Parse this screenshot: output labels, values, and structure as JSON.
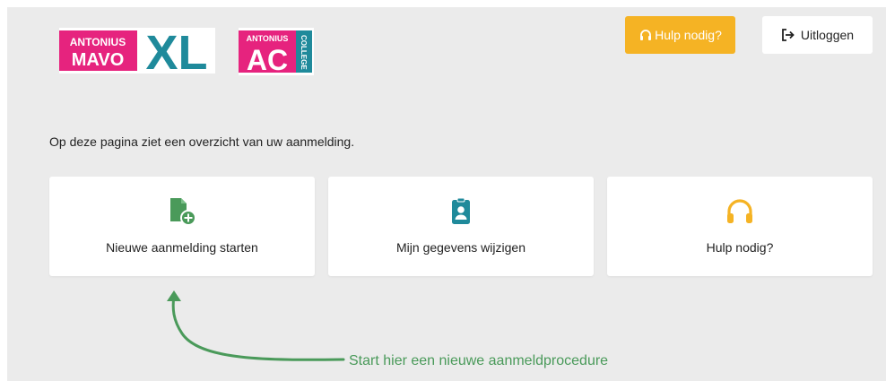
{
  "header": {
    "logo_mavo": {
      "line1": "ANTONIUS",
      "line2": "MAVO",
      "suffix": "XL"
    },
    "logo_college": {
      "line1": "ANTONIUS",
      "letters": "AC",
      "side": "COLLEGE"
    },
    "help_button_label": "Hulp nodig?",
    "logout_button_label": "Uitloggen"
  },
  "intro_text": "Op deze pagina ziet een overzicht van uw aanmelding.",
  "cards": [
    {
      "label": "Nieuwe aanmelding starten",
      "icon": "file-plus-icon",
      "color": "#4a9a5a"
    },
    {
      "label": "Mijn gegevens wijzigen",
      "icon": "id-badge-icon",
      "color": "#1f8a9b"
    },
    {
      "label": "Hulp nodig?",
      "icon": "headphones-icon",
      "color": "#f5b324"
    }
  ],
  "hint_text": "Start hier een nieuwe aanmeldprocedure",
  "colors": {
    "pink": "#e6237e",
    "teal": "#1f8a9b",
    "orange": "#f5b324",
    "green": "#4a9a5a",
    "background": "#ebebeb"
  }
}
